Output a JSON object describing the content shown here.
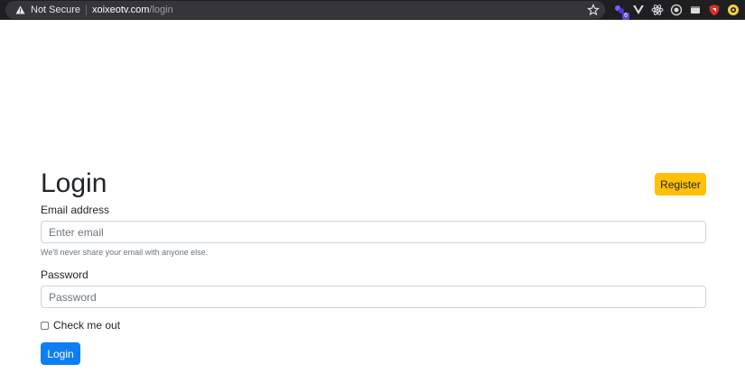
{
  "browser": {
    "security_label": "Not Secure",
    "url_host": "xoixeotv.com",
    "url_path": "/login",
    "extension_badge": "6",
    "extensions": [
      "extension-icon-purple",
      "vue-devtools-icon",
      "react-devtools-icon",
      "target-icon",
      "window-icon",
      "shield-icon",
      "lens-icon"
    ]
  },
  "page": {
    "title": "Login",
    "register_label": "Register",
    "email": {
      "label": "Email address",
      "placeholder": "Enter email",
      "help": "We'll never share your email with anyone else."
    },
    "password": {
      "label": "Password",
      "placeholder": "Password"
    },
    "remember_label": "Check me out",
    "submit_label": "Login"
  },
  "colors": {
    "primary": "#0d7ff2",
    "warning": "#ffc107",
    "chrome_bar": "#1f1f21"
  }
}
